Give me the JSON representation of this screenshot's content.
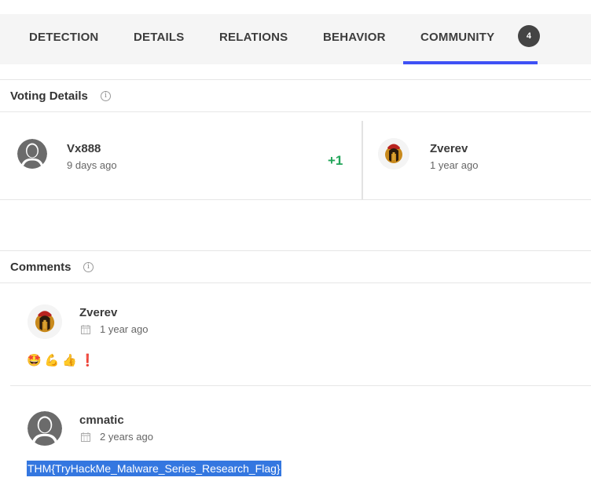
{
  "tabs": [
    {
      "label": "DETECTION"
    },
    {
      "label": "DETAILS"
    },
    {
      "label": "RELATIONS"
    },
    {
      "label": "BEHAVIOR"
    },
    {
      "label": "COMMUNITY",
      "badge": "4",
      "active": true
    }
  ],
  "voting": {
    "title": "Voting Details",
    "votes": [
      {
        "user": "Vx888",
        "time": "9 days ago",
        "vote": "+1",
        "avatar": "default-user-icon"
      },
      {
        "user": "Zverev",
        "time": "1 year ago",
        "avatar": "spartan-helmet-icon"
      }
    ]
  },
  "comments": {
    "title": "Comments",
    "items": [
      {
        "user": "Zverev",
        "time": "1 year ago",
        "avatar": "spartan-helmet-icon",
        "emojis": [
          "🤩",
          "💪",
          "👍",
          "❗"
        ]
      },
      {
        "user": "cmnatic",
        "time": "2 years ago",
        "avatar": "default-user-icon",
        "text": "THM{TryHackMe_Malware_Series_Research_Flag}"
      }
    ]
  },
  "colors": {
    "accent": "#3f51f5",
    "vote_positive": "#22a55a",
    "selection": "#3477e0"
  }
}
